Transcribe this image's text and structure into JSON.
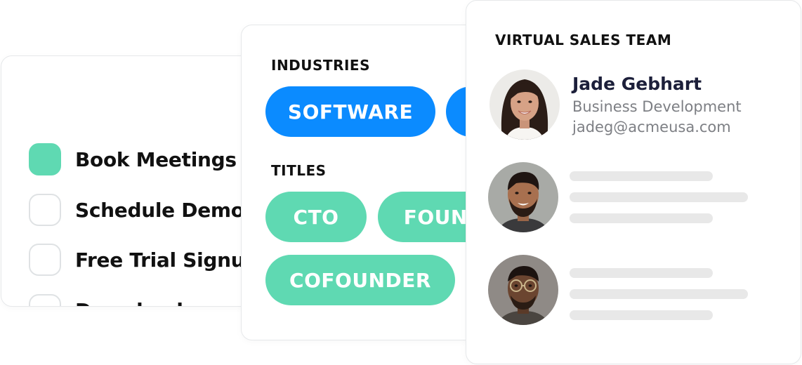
{
  "goals": {
    "items": [
      {
        "label": "Book Meetings",
        "checked": true
      },
      {
        "label": "Schedule Demo",
        "checked": false
      },
      {
        "label": "Free Trial Signup",
        "checked": false
      },
      {
        "label": "Download",
        "checked": false
      }
    ]
  },
  "industries": {
    "heading": "INDUSTRIES",
    "tags": [
      "SOFTWARE",
      ""
    ]
  },
  "titles": {
    "heading": "TITLES",
    "tags": [
      "CTO",
      "FOUNDER",
      "COFOUNDER"
    ]
  },
  "team": {
    "heading": "VIRTUAL SALES TEAM",
    "members": [
      {
        "name": "Jade Gebhart",
        "role": "Business Development",
        "email": "jadeg@acmeusa.com"
      }
    ]
  },
  "colors": {
    "green": "#5fd9b2",
    "blue": "#0b8bff",
    "skeleton": "#e8e8e8"
  }
}
